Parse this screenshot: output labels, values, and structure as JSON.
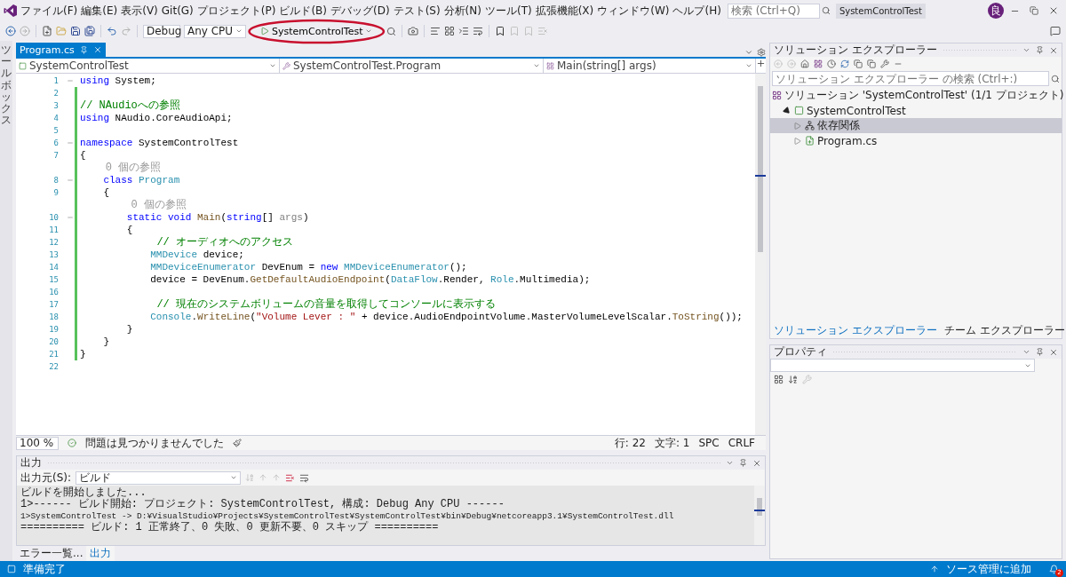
{
  "title_bar": {
    "menu": [
      "ファイル(F)",
      "編集(E)",
      "表示(V)",
      "Git(G)",
      "プロジェクト(P)",
      "ビルド(B)",
      "デバッグ(D)",
      "テスト(S)",
      "分析(N)",
      "ツール(T)",
      "拡張機能(X)",
      "ウィンドウ(W)",
      "ヘルプ(H)"
    ],
    "search": {
      "placeholder": "検索 (Ctrl+Q)"
    },
    "solution_name": "SystemControlTest",
    "avatar": "良"
  },
  "toolbar": {
    "configuration": "Debug",
    "platform": "Any CPU",
    "start_label": "SystemControlTest"
  },
  "toolbox_label": "ツールボックス",
  "editor": {
    "tabs": [
      {
        "label": "Program.cs",
        "selected": true
      }
    ],
    "nav": [
      "SystemControlTest",
      "SystemControlTest.Program",
      "Main(string[] args)"
    ],
    "lines": [
      {
        "number": "1",
        "fold": true,
        "changed": false,
        "tokens": [
          {
            "kind": "keyword",
            "text": "using"
          },
          {
            "kind": "plain",
            "text": " System;"
          }
        ]
      },
      {
        "number": "2",
        "fold": false,
        "changed": true
      },
      {
        "number": "3",
        "fold": false,
        "changed": true,
        "tokens": [
          {
            "kind": "comment",
            "text": "// NAudioへの参照"
          }
        ]
      },
      {
        "number": "4",
        "fold": false,
        "changed": true,
        "tokens": [
          {
            "kind": "keyword",
            "text": "using"
          },
          {
            "kind": "plain",
            "text": " NAudio.CoreAudioApi;"
          }
        ]
      },
      {
        "number": "5",
        "fold": false,
        "changed": true
      },
      {
        "number": "6",
        "fold": true,
        "changed": true,
        "tokens": [
          {
            "kind": "keyword",
            "text": "namespace"
          },
          {
            "kind": "plain",
            "text": " SystemControlTest"
          }
        ]
      },
      {
        "number": "7",
        "fold": false,
        "changed": true,
        "tokens": [
          {
            "kind": "plain",
            "text": "{"
          }
        ]
      },
      {
        "number": "8",
        "fold": true,
        "changed": true,
        "lens": "0 個の参照",
        "tokens": [
          {
            "kind": "keyword",
            "text": "    class"
          },
          {
            "kind": "type",
            "text": " Program"
          }
        ]
      },
      {
        "number": "9",
        "fold": false,
        "changed": true,
        "tokens": [
          {
            "kind": "plain",
            "text": "    {"
          }
        ]
      },
      {
        "number": "10",
        "fold": true,
        "changed": true,
        "lens": "0 個の参照",
        "tokens": [
          {
            "kind": "keyword",
            "text": "        static void"
          },
          {
            "kind": "method",
            "text": " Main"
          },
          {
            "kind": "plain",
            "text": "("
          },
          {
            "kind": "keyword",
            "text": "string"
          },
          {
            "kind": "plain",
            "text": "[] "
          },
          {
            "kind": "param",
            "text": "args"
          },
          {
            "kind": "plain",
            "text": ")"
          }
        ]
      },
      {
        "number": "11",
        "fold": false,
        "changed": true,
        "tokens": [
          {
            "kind": "plain",
            "text": "        {"
          }
        ]
      },
      {
        "number": "12",
        "fold": false,
        "changed": true,
        "tokens": [
          {
            "kind": "comment",
            "text": "            // オーディオへのアクセス"
          }
        ]
      },
      {
        "number": "13",
        "fold": false,
        "changed": true,
        "tokens": [
          {
            "kind": "type",
            "text": "            MMDevice"
          },
          {
            "kind": "plain",
            "text": " device;"
          }
        ]
      },
      {
        "number": "14",
        "fold": false,
        "changed": true,
        "tokens": [
          {
            "kind": "type",
            "text": "            MMDeviceEnumerator"
          },
          {
            "kind": "plain",
            "text": " DevEnum = "
          },
          {
            "kind": "keyword",
            "text": "new"
          },
          {
            "kind": "type",
            "text": " MMDeviceEnumerator"
          },
          {
            "kind": "plain",
            "text": "();"
          }
        ]
      },
      {
        "number": "15",
        "fold": false,
        "changed": true,
        "tokens": [
          {
            "kind": "plain",
            "text": "            device = DevEnum."
          },
          {
            "kind": "method",
            "text": "GetDefaultAudioEndpoint"
          },
          {
            "kind": "plain",
            "text": "("
          },
          {
            "kind": "type",
            "text": "DataFlow"
          },
          {
            "kind": "plain",
            "text": ".Render, "
          },
          {
            "kind": "type",
            "text": "Role"
          },
          {
            "kind": "plain",
            "text": ".Multimedia);"
          }
        ]
      },
      {
        "number": "16",
        "fold": false,
        "changed": true
      },
      {
        "number": "17",
        "fold": false,
        "changed": true,
        "tokens": [
          {
            "kind": "comment",
            "text": "            // 現在のシステムボリュームの音量を取得してコンソールに表示する"
          }
        ]
      },
      {
        "number": "18",
        "fold": false,
        "changed": true,
        "tokens": [
          {
            "kind": "type",
            "text": "            Console"
          },
          {
            "kind": "plain",
            "text": "."
          },
          {
            "kind": "method",
            "text": "WriteLine"
          },
          {
            "kind": "plain",
            "text": "("
          },
          {
            "kind": "string",
            "text": "\"Volume Lever : \""
          },
          {
            "kind": "plain",
            "text": " + device.AudioEndpointVolume.MasterVolumeLevelScalar."
          },
          {
            "kind": "method",
            "text": "ToString"
          },
          {
            "kind": "plain",
            "text": "());"
          }
        ]
      },
      {
        "number": "19",
        "fold": false,
        "changed": true,
        "tokens": [
          {
            "kind": "plain",
            "text": "        }"
          }
        ]
      },
      {
        "number": "20",
        "fold": false,
        "changed": true,
        "tokens": [
          {
            "kind": "plain",
            "text": "    }"
          }
        ]
      },
      {
        "number": "21",
        "fold": false,
        "changed": true,
        "tokens": [
          {
            "kind": "plain",
            "text": "}"
          }
        ]
      },
      {
        "number": "22",
        "fold": false,
        "changed": false
      }
    ]
  },
  "editor_status": {
    "zoom": "100 %",
    "issues": "問題は見つかりませんでした",
    "line": "行: 22",
    "column": "文字: 1",
    "indent": "SPC",
    "line_ending": "CRLF"
  },
  "output": {
    "title": "出力",
    "source_label": "出力元(S):",
    "source": "ビルド",
    "lines": [
      "ビルドを開始しました...",
      "1>------ ビルド開始: プロジェクト: SystemControlTest, 構成: Debug Any CPU ------",
      "1>SystemControlTest -> D:¥VisualStudio¥Projects¥SystemControlTest¥SystemControlTest¥bin¥Debug¥netcoreapp3.1¥SystemControlTest.dll",
      "========== ビルド: 1 正常終了、0 失敗、0 更新不要、0 スキップ =========="
    ]
  },
  "bottom_tabs": [
    {
      "label": "エラー一覧...",
      "selected": false
    },
    {
      "label": "出力",
      "selected": true
    }
  ],
  "solution_explorer": {
    "title": "ソリューション エクスプローラー",
    "search": {
      "placeholder": "ソリューション エクスプローラー の検索 (Ctrl+:)"
    },
    "tree": {
      "kind": "solution",
      "label": "ソリューション 'SystemControlTest' (1/1 プロジェクト)",
      "children": [
        {
          "kind": "project",
          "label": "SystemControlTest",
          "expanded": true,
          "selected": false,
          "children": [
            {
              "kind": "dependencies",
              "label": "依存関係",
              "expanded": false,
              "selected": true
            },
            {
              "kind": "csfile",
              "label": "Program.cs",
              "expanded": false,
              "selected": false
            }
          ]
        }
      ]
    },
    "tabs": [
      {
        "label": "ソリューション エクスプローラー",
        "selected": true
      },
      {
        "label": "チーム エクスプローラー",
        "selected": false
      }
    ]
  },
  "properties": {
    "title": "プロパティ"
  },
  "status_bar": {
    "message": "準備完了",
    "source_control": "ソース管理に追加",
    "notifications": "2"
  }
}
